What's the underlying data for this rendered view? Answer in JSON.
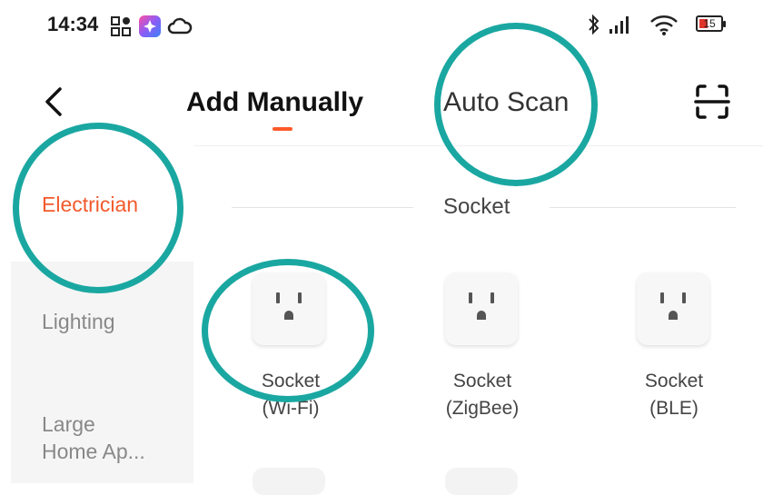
{
  "status_bar": {
    "time": "14:34",
    "battery": "15"
  },
  "header": {
    "tabs": [
      {
        "label": "Add Manually",
        "active": true
      },
      {
        "label": "Auto Scan",
        "active": false
      }
    ]
  },
  "sidebar": {
    "items": [
      {
        "label": "Electrician",
        "active": true
      },
      {
        "label": "Lighting",
        "active": false
      },
      {
        "label": "Large\nHome Ap...",
        "active": false
      }
    ]
  },
  "main": {
    "section_title": "Socket",
    "devices": [
      {
        "label": "Socket\n(Wi-Fi)"
      },
      {
        "label": "Socket\n(ZigBee)"
      },
      {
        "label": "Socket\n(BLE)"
      }
    ]
  },
  "colors": {
    "accent": "#f25a2c",
    "highlight": "#1aa7a1"
  }
}
